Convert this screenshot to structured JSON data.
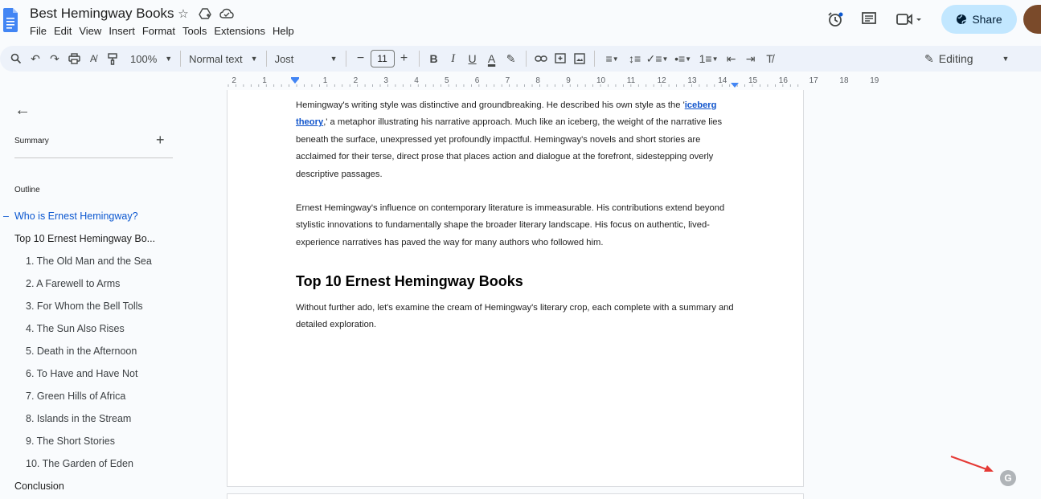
{
  "header": {
    "title": "Best Hemingway Books",
    "menu": [
      "File",
      "Edit",
      "View",
      "Insert",
      "Format",
      "Tools",
      "Extensions",
      "Help"
    ],
    "share_label": "Share",
    "icons": [
      "star-icon",
      "move-to-drive-icon",
      "cloud-status-icon",
      "history-icon",
      "comments-icon",
      "meet-icon"
    ]
  },
  "toolbar": {
    "zoom": "100%",
    "style": "Normal text",
    "font": "Jost",
    "font_size": "11",
    "mode": "Editing"
  },
  "ruler": {
    "labels": [
      "2",
      "1",
      "1",
      "2",
      "3",
      "4",
      "5",
      "6",
      "7",
      "8",
      "9",
      "10",
      "11",
      "12",
      "13",
      "14",
      "15",
      "16",
      "17",
      "18",
      "19"
    ]
  },
  "sidebar": {
    "summary_label": "Summary",
    "outline_label": "Outline",
    "items": [
      {
        "label": "Who is Ernest Hemingway?",
        "level": 0,
        "active": true
      },
      {
        "label": "Top 10 Ernest Hemingway Bo...",
        "level": 0,
        "active": false
      },
      {
        "label": "1. The Old Man and the Sea",
        "level": 1,
        "active": false
      },
      {
        "label": "2. A Farewell to Arms",
        "level": 1,
        "active": false
      },
      {
        "label": "3. For Whom the Bell Tolls",
        "level": 1,
        "active": false
      },
      {
        "label": "4. The Sun Also Rises",
        "level": 1,
        "active": false
      },
      {
        "label": "5. Death in the Afternoon",
        "level": 1,
        "active": false
      },
      {
        "label": "6. To Have and Have Not",
        "level": 1,
        "active": false
      },
      {
        "label": "7. Green Hills of Africa",
        "level": 1,
        "active": false
      },
      {
        "label": "8. Islands in the Stream",
        "level": 1,
        "active": false
      },
      {
        "label": "9. The Short Stories",
        "level": 1,
        "active": false
      },
      {
        "label": "10. The Garden of Eden",
        "level": 1,
        "active": false
      },
      {
        "label": "Conclusion",
        "level": 0,
        "active": false
      }
    ]
  },
  "document": {
    "p1_before_link": "Hemingway's writing style was distinctive and groundbreaking. He described his own style as the '",
    "p1_link": "iceberg theory",
    "p1_after_link": ",' a metaphor illustrating his narrative approach. Much like an iceberg, the weight of the narrative lies beneath the surface, unexpressed yet profoundly impactful. Hemingway's novels and short stories are acclaimed for their terse, direct prose that places action and dialogue at the forefront, sidestepping overly descriptive passages.",
    "p2": "Ernest Hemingway's influence on contemporary literature is immeasurable. His contributions extend beyond stylistic innovations to fundamentally shape the broader literary landscape. His focus on authentic, lived-experience narratives has paved the way for many authors who followed him.",
    "heading": "Top 10 Ernest Hemingway Books",
    "p3": "Without further ado, let's examine the cream of Hemingway's literary crop, each complete with a summary and detailed exploration."
  },
  "colors": {
    "accent": "#0b57d0",
    "share_bg": "#c2e7ff",
    "toolbar_bg": "#edf2fa",
    "arrow": "#e53935"
  }
}
